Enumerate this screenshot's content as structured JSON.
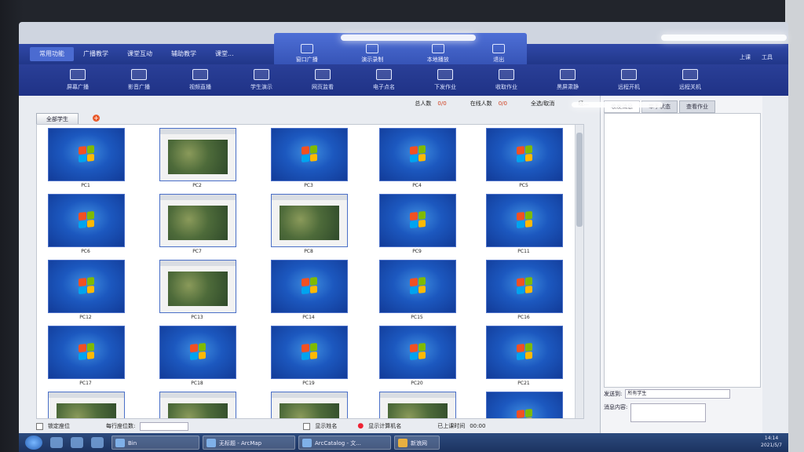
{
  "menubar": {
    "tabs": [
      "常用功能",
      "广播教学",
      "课堂互动",
      "辅助教学",
      "课堂..."
    ],
    "active": 0,
    "controls": [
      "上课",
      "工具"
    ]
  },
  "popup": {
    "items": [
      "窗口广播",
      "演示录制",
      "本地播放",
      "退出"
    ]
  },
  "toolbar": {
    "items": [
      "屏幕广播",
      "影音广播",
      "视频直播",
      "学生演示",
      "网页监看",
      "电子点名",
      "下发作业",
      "收取作业",
      "黑屏肃静",
      "远程开机",
      "远程关机"
    ]
  },
  "stats": {
    "total_label": "总人数",
    "total_value": "0/0",
    "online_label": "在线人数",
    "online_value": "0/0",
    "select_all": "全选/取消",
    "mode": "经..."
  },
  "group_tab": "全部学生",
  "students": [
    {
      "name": "PC1",
      "screen": "win7"
    },
    {
      "name": "PC2",
      "screen": "gis"
    },
    {
      "name": "PC3",
      "screen": "win7"
    },
    {
      "name": "PC4",
      "screen": "win7"
    },
    {
      "name": "PC5",
      "screen": "win7"
    },
    {
      "name": "PC6",
      "screen": "win7"
    },
    {
      "name": "PC7",
      "screen": "gis"
    },
    {
      "name": "PC8",
      "screen": "gis"
    },
    {
      "name": "PC9",
      "screen": "win7"
    },
    {
      "name": "PC11",
      "screen": "win7"
    },
    {
      "name": "PC12",
      "screen": "win7"
    },
    {
      "name": "PC13",
      "screen": "gis"
    },
    {
      "name": "PC14",
      "screen": "win7"
    },
    {
      "name": "PC15",
      "screen": "win7"
    },
    {
      "name": "PC16",
      "screen": "win7"
    },
    {
      "name": "PC17",
      "screen": "win7"
    },
    {
      "name": "PC18",
      "screen": "win7"
    },
    {
      "name": "PC19",
      "screen": "win7"
    },
    {
      "name": "PC20",
      "screen": "win7"
    },
    {
      "name": "PC21",
      "screen": "win7"
    },
    {
      "name": "",
      "screen": "gis"
    },
    {
      "name": "",
      "screen": "gis"
    },
    {
      "name": "",
      "screen": "gis"
    },
    {
      "name": "",
      "screen": "gis"
    },
    {
      "name": "",
      "screen": "win7"
    }
  ],
  "bottom": {
    "lock_seat": "锁定座位",
    "per_row": "每行座位数:",
    "show_name": "显示姓名",
    "show_pc": "显示计算机名",
    "class_time_label": "已上课时间",
    "class_time_value": "00:00"
  },
  "right_panel": {
    "tabs": [
      "收发消息",
      "举手状态",
      "查看作业"
    ],
    "send_to_label": "发送到:",
    "send_to_value": "所有学生",
    "message_label": "消息内容:"
  },
  "taskbar": {
    "tasks": [
      "Bin",
      "无标题 - ArcMap",
      "ArcCatalog - 文...",
      "新浪网"
    ],
    "time": "14:14",
    "date": "2021/5/7"
  },
  "colors": {
    "menubar": "#213789",
    "toolbar": "#1f3286",
    "popup": "#3553b5",
    "stat_value": "#d04020",
    "win7_blue": "#1c58bf"
  }
}
